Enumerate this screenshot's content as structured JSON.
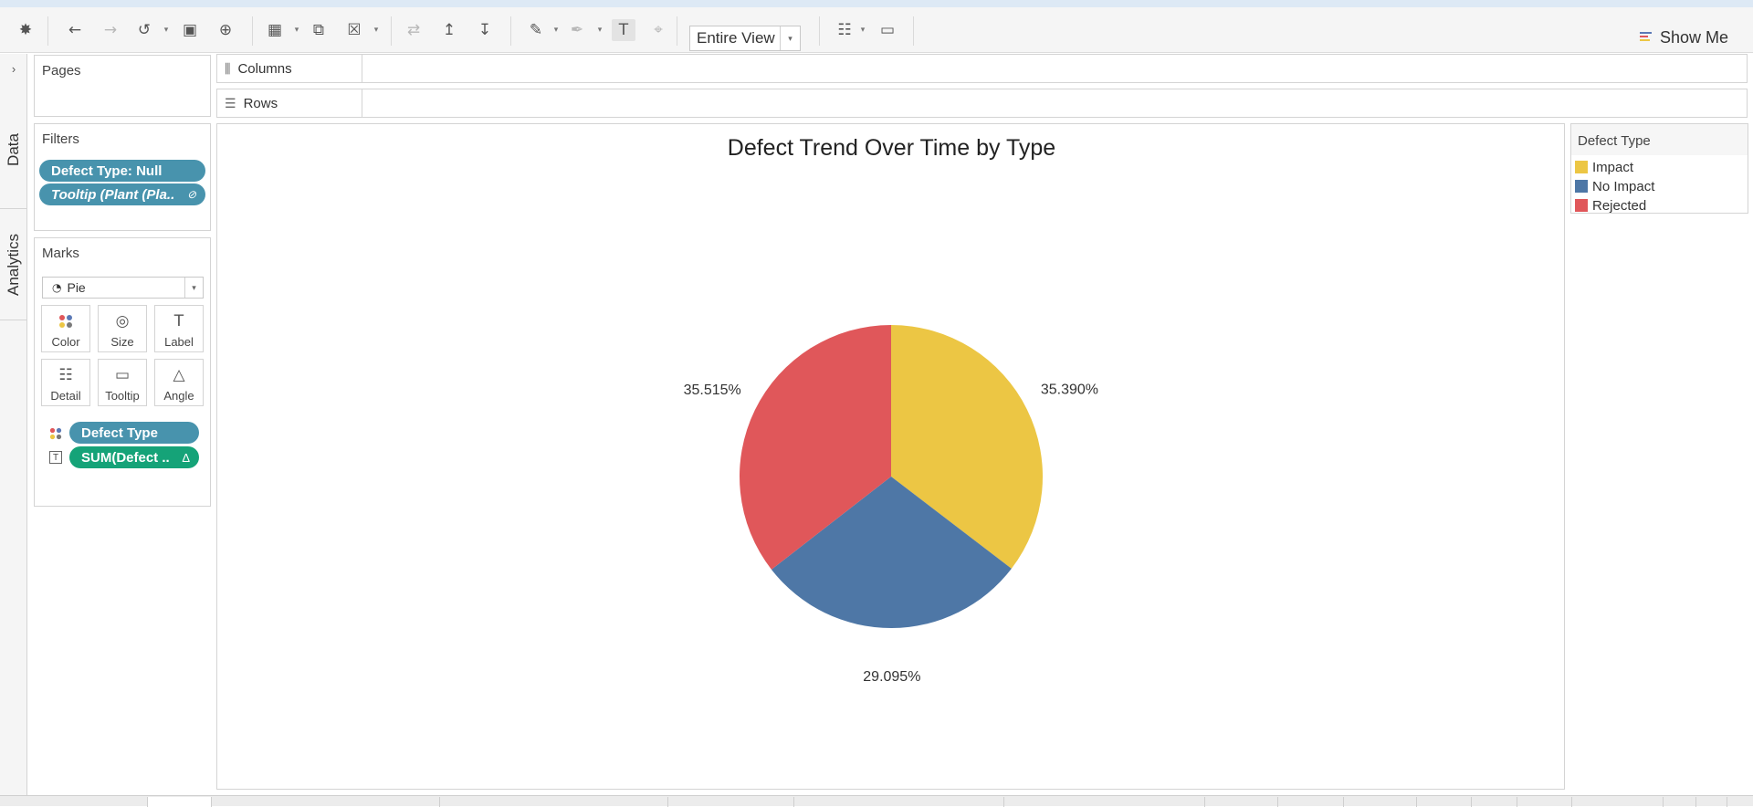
{
  "toolbar": {
    "buttons": [
      {
        "name": "tableau-logo-icon",
        "glyph": "✸"
      },
      {
        "name": "undo-icon",
        "glyph": "←"
      },
      {
        "name": "redo-icon",
        "glyph": "→"
      },
      {
        "name": "replay-icon",
        "glyph": "↺"
      },
      {
        "name": "save-icon",
        "glyph": "▣"
      },
      {
        "name": "new-data-source-icon",
        "glyph": "⊕"
      },
      {
        "name": "new-worksheet-icon",
        "glyph": "▦"
      },
      {
        "name": "duplicate-sheet-icon",
        "glyph": "⧉"
      },
      {
        "name": "clear-sheet-icon",
        "glyph": "☒"
      },
      {
        "name": "swap-rows-columns-icon",
        "glyph": "⇄"
      },
      {
        "name": "sort-ascending-icon",
        "glyph": "↥"
      },
      {
        "name": "sort-descending-icon",
        "glyph": "↧"
      },
      {
        "name": "highlight-icon",
        "glyph": "✎"
      },
      {
        "name": "group-members-icon",
        "glyph": "✒"
      },
      {
        "name": "show-mark-labels-icon",
        "glyph": "T"
      },
      {
        "name": "fix-axes-icon",
        "glyph": "⌖"
      },
      {
        "name": "show-cards-icon",
        "glyph": "☷"
      },
      {
        "name": "presentation-mode-icon",
        "glyph": "▭"
      }
    ],
    "fit_value": "Entire View",
    "show_me_label": "Show Me"
  },
  "side_tabs": {
    "data": "Data",
    "analytics": "Analytics"
  },
  "pages_panel": {
    "title": "Pages"
  },
  "filters_panel": {
    "title": "Filters",
    "pills": [
      "Defect Type: Null",
      "Tooltip (Plant (Pla.."
    ]
  },
  "marks_panel": {
    "title": "Marks",
    "mark_type": "Pie",
    "buttons": [
      {
        "label": "Color",
        "icon": "color-icon",
        "glyph": "⬤"
      },
      {
        "label": "Size",
        "icon": "size-icon",
        "glyph": "◎"
      },
      {
        "label": "Label",
        "icon": "label-icon",
        "glyph": "T"
      },
      {
        "label": "Detail",
        "icon": "detail-icon",
        "glyph": "☷"
      },
      {
        "label": "Tooltip",
        "icon": "tooltip-icon",
        "glyph": "▭"
      },
      {
        "label": "Angle",
        "icon": "angle-icon",
        "glyph": "△"
      }
    ],
    "pills": [
      "Defect Type",
      "SUM(Defect .."
    ]
  },
  "shelves": {
    "columns": "Columns",
    "rows": "Rows"
  },
  "chart_data": {
    "type": "pie",
    "title": "Defect Trend Over Time by Type",
    "slices": [
      {
        "category": "Impact",
        "value": 35.39,
        "label": "35.390%",
        "color": "#ecc644"
      },
      {
        "category": "No Impact",
        "value": 29.095,
        "label": "29.095%",
        "color": "#4e77a6"
      },
      {
        "category": "Rejected",
        "value": 35.515,
        "label": "35.515%",
        "color": "#e0575a"
      }
    ],
    "legend_placement": "right"
  },
  "legend": {
    "title": "Defect Type",
    "items": [
      {
        "label": "Impact",
        "color": "#ecc644"
      },
      {
        "label": "No Impact",
        "color": "#4e77a6"
      },
      {
        "label": "Rejected",
        "color": "#e0575a"
      }
    ]
  }
}
